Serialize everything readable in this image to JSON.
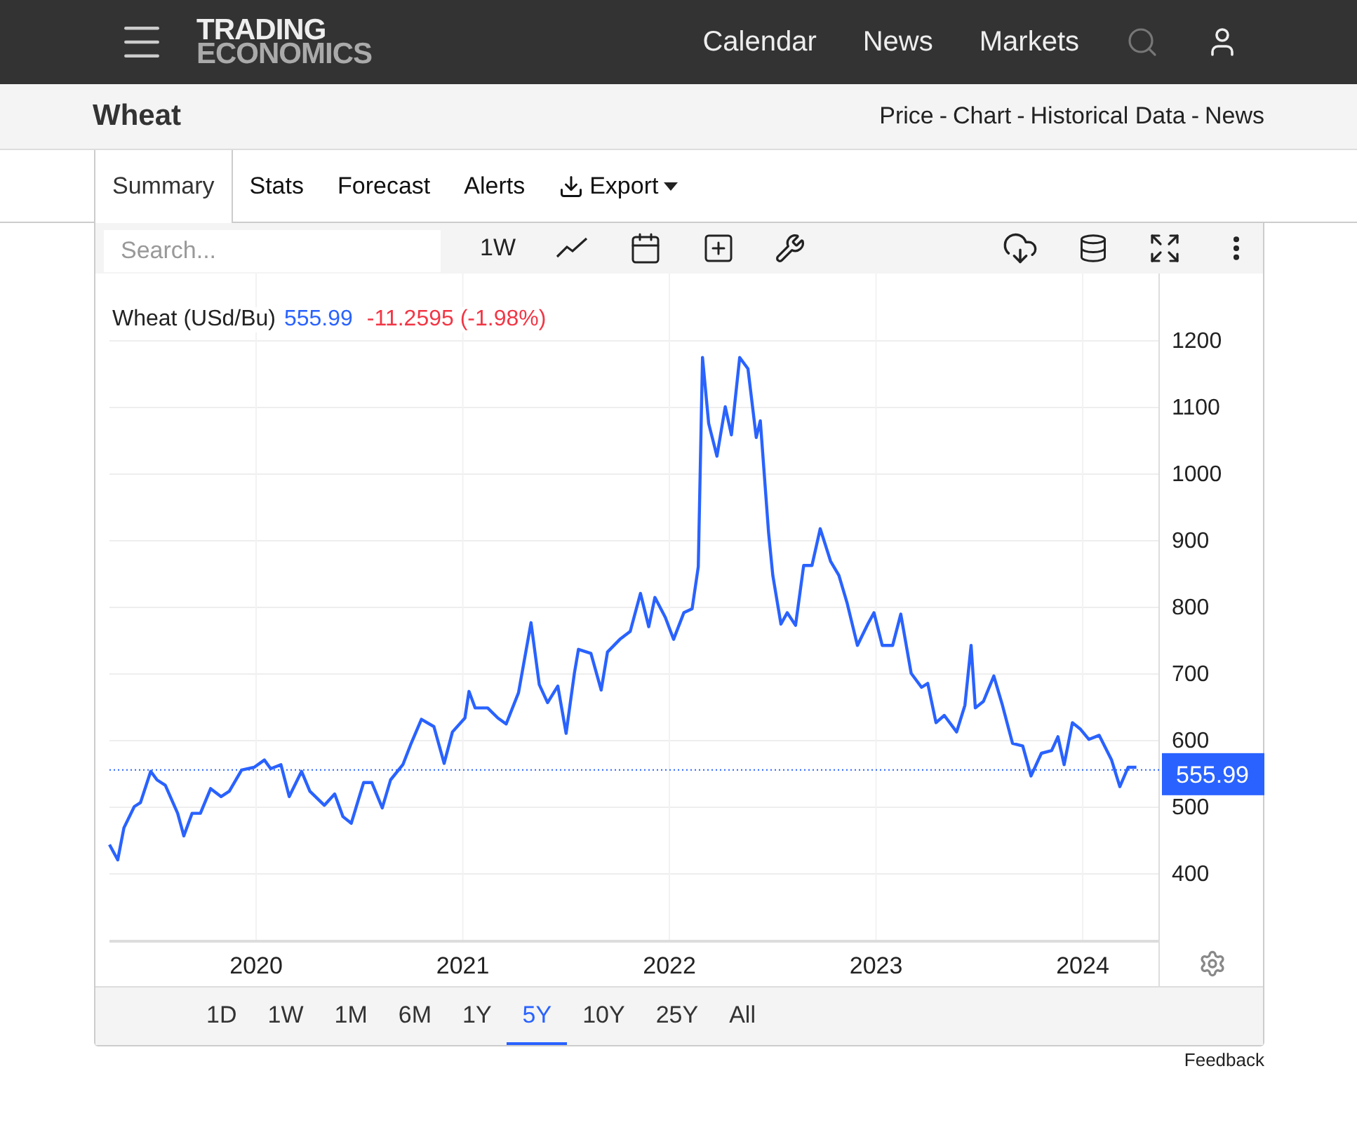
{
  "header": {
    "logo": [
      "TRADING",
      "ECONOMICS"
    ],
    "nav": [
      "Calendar",
      "News",
      "Markets"
    ]
  },
  "subheader": {
    "title": "Wheat",
    "separator": "-",
    "links": [
      "Price",
      "Chart",
      "Historical Data",
      "News"
    ]
  },
  "tabs": [
    {
      "label": "Summary",
      "selected": true,
      "kind": "tab"
    },
    {
      "label": "Stats",
      "selected": false,
      "kind": "tab"
    },
    {
      "label": "Forecast",
      "selected": false,
      "kind": "tab"
    },
    {
      "label": "Alerts",
      "selected": false,
      "kind": "tab"
    },
    {
      "label": "Export",
      "selected": false,
      "kind": "menu"
    }
  ],
  "toolbar": {
    "placeholder": "Search...",
    "interval": "1W"
  },
  "chart": {
    "legend": {
      "name": "Wheat (USd/Bu)",
      "price": "555.99",
      "change": "-11.2595 (-1.98%)"
    },
    "chart_data": {
      "type": "line",
      "grid": true,
      "ref_lines": [
        {
          "axis": "y",
          "value": 555.99,
          "label": "555.99",
          "color": "#2962ff"
        }
      ],
      "xlim": [
        2019.29,
        2024.37
      ],
      "ylim": [
        299,
        1301
      ],
      "xticks": [
        {
          "value": 2020,
          "label": "2020"
        },
        {
          "value": 2021,
          "label": "2021"
        },
        {
          "value": 2022,
          "label": "2022"
        },
        {
          "value": 2023,
          "label": "2023"
        },
        {
          "value": 2024,
          "label": "2024"
        }
      ],
      "yticks": [
        400,
        500,
        600,
        700,
        800,
        900,
        1000,
        1100,
        1200
      ],
      "x": [
        2019.29,
        2019.33,
        2019.36,
        2019.41,
        2019.44,
        2019.49,
        2019.52,
        2019.56,
        2019.59,
        2019.62,
        2019.65,
        2019.69,
        2019.73,
        2019.78,
        2019.83,
        2019.87,
        2019.93,
        2019.99,
        2020.04,
        2020.07,
        2020.12,
        2020.16,
        2020.22,
        2020.26,
        2020.33,
        2020.38,
        2020.42,
        2020.46,
        2020.52,
        2020.56,
        2020.61,
        2020.65,
        2020.71,
        2020.75,
        2020.8,
        2020.86,
        2020.91,
        2020.95,
        2021.01,
        2021.03,
        2021.06,
        2021.12,
        2021.17,
        2021.21,
        2021.27,
        2021.33,
        2021.37,
        2021.41,
        2021.46,
        2021.5,
        2021.54,
        2021.56,
        2021.62,
        2021.67,
        2021.7,
        2021.76,
        2021.81,
        2021.86,
        2021.9,
        2021.93,
        2021.98,
        2022.02,
        2022.07,
        2022.11,
        2022.14,
        2022.16,
        2022.19,
        2022.23,
        2022.27,
        2022.3,
        2022.34,
        2022.38,
        2022.42,
        2022.44,
        2022.48,
        2022.5,
        2022.54,
        2022.57,
        2022.61,
        2022.65,
        2022.69,
        2022.73,
        2022.78,
        2022.82,
        2022.86,
        2022.91,
        2022.96,
        2022.99,
        2023.03,
        2023.08,
        2023.12,
        2023.17,
        2023.22,
        2023.25,
        2023.29,
        2023.33,
        2023.39,
        2023.43,
        2023.46,
        2023.48,
        2023.52,
        2023.57,
        2023.61,
        2023.66,
        2023.71,
        2023.75,
        2023.8,
        2023.85,
        2023.88,
        2023.91,
        2023.95,
        2023.99,
        2024.03,
        2024.08,
        2024.14,
        2024.18,
        2024.22,
        2024.26
      ],
      "series": [
        {
          "color": "#2962ff",
          "values": [
            444,
            421,
            469,
            501,
            507,
            554,
            541,
            533,
            512,
            491,
            457,
            491,
            491,
            528,
            516,
            524,
            556,
            560,
            571,
            558,
            564,
            516,
            554,
            524,
            503,
            520,
            486,
            476,
            537,
            537,
            499,
            541,
            564,
            596,
            632,
            621,
            566,
            613,
            634,
            674,
            649,
            649,
            634,
            625,
            672,
            777,
            684,
            657,
            682,
            611,
            701,
            737,
            731,
            676,
            733,
            752,
            764,
            821,
            771,
            815,
            785,
            752,
            792,
            798,
            861,
            1175,
            1076,
            1027,
            1101,
            1059,
            1175,
            1158,
            1055,
            1080,
            912,
            848,
            775,
            792,
            773,
            863,
            863,
            918,
            869,
            848,
            806,
            743,
            775,
            792,
            743,
            743,
            790,
            701,
            680,
            686,
            627,
            638,
            613,
            653,
            743,
            649,
            659,
            697,
            655,
            596,
            592,
            547,
            581,
            585,
            606,
            564,
            627,
            617,
            602,
            608,
            571,
            531,
            560,
            560
          ]
        }
      ]
    }
  },
  "ranges": [
    {
      "label": "1D",
      "selected": false
    },
    {
      "label": "1W",
      "selected": false
    },
    {
      "label": "1M",
      "selected": false
    },
    {
      "label": "6M",
      "selected": false
    },
    {
      "label": "1Y",
      "selected": false
    },
    {
      "label": "5Y",
      "selected": true
    },
    {
      "label": "10Y",
      "selected": false
    },
    {
      "label": "25Y",
      "selected": false
    },
    {
      "label": "All",
      "selected": false
    }
  ],
  "feedback": "Feedback"
}
